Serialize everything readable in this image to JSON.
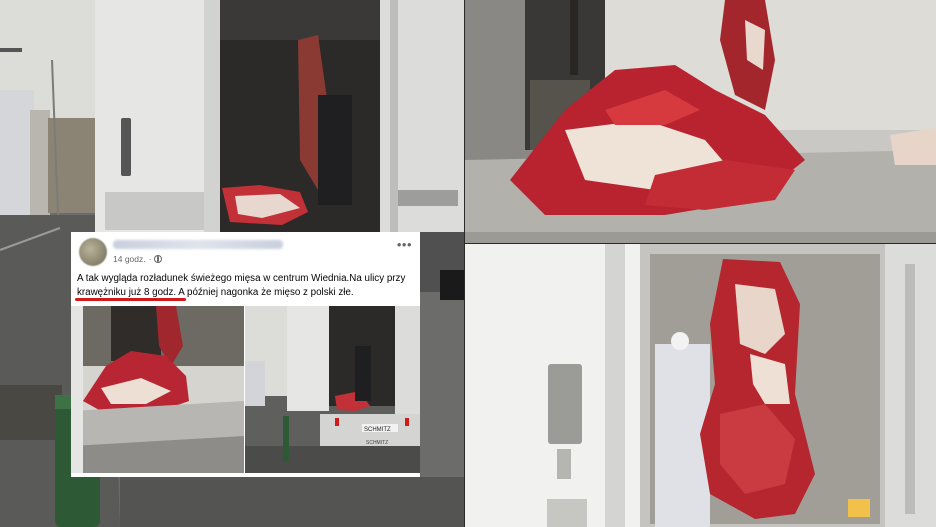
{
  "post": {
    "time": "14 godz.",
    "line1": "A tak wygląda rozładunek świeżego mięsa w centrum Wiednia.Na ulicy przy",
    "line2": "krawężniku już 8 godz. A później nagonka że mięso z polski złe.",
    "more": "•••"
  },
  "truck_plate": "SCHMITZ",
  "truck_logo": "SCHMITZ",
  "colors": {
    "underline": "#d11a1a",
    "meat": "#b8232f",
    "fat": "#efe2d6"
  },
  "icons": [
    "globe-icon",
    "more-icon"
  ]
}
